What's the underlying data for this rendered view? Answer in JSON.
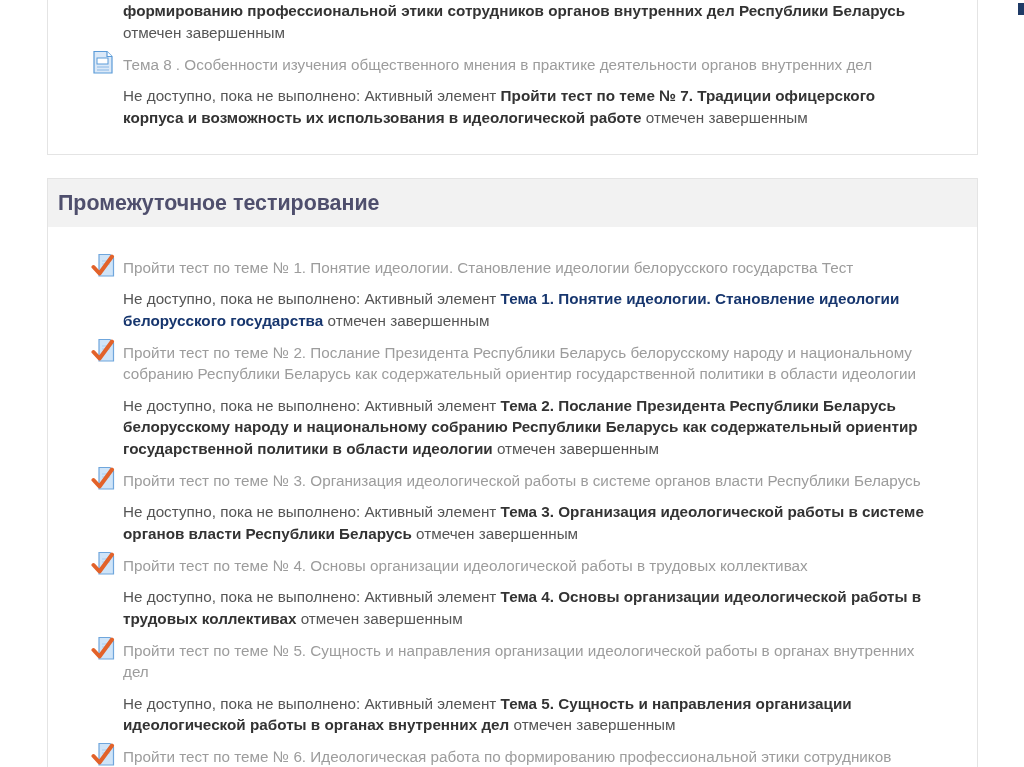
{
  "sections": [
    {
      "cut_top": true,
      "items": [
        {
          "restriction": {
            "target": "формированию профессиональной этики сотрудников органов внутренних дел Республики Беларусь",
            "suffix": "отмечен завершенным",
            "highlighted": false
          }
        },
        {
          "activity": {
            "kind": "page",
            "title": "Тема 8 . Особенности изучения общественного мнения в практике деятельности органов внутренних дел",
            "disabled": true
          },
          "restriction": {
            "prefix": "Не доступно, пока не выполнено: Активный элемент",
            "target": "Пройти тест по теме № 7. Традиции офицерского корпуса и возможность их использования в идеологической работе",
            "suffix": "отмечен завершенным",
            "highlighted": false
          }
        }
      ]
    },
    {
      "cut_top": false,
      "title": "Промежуточное тестирование",
      "items": [
        {
          "activity": {
            "kind": "quiz",
            "title": "Пройти тест по теме № 1. Понятие идеологии. Становление идеологии белорусского государства Тест",
            "disabled": true
          },
          "restriction": {
            "prefix": "Не доступно, пока не выполнено: Активный элемент",
            "target": "Тема 1. Понятие идеологии. Становление идеологии белорусского государства",
            "suffix": "отмечен завершенным",
            "highlighted": true
          }
        },
        {
          "activity": {
            "kind": "quiz",
            "title": "Пройти тест по теме № 2. Послание Президента Республики Беларусь белорусскому народу и национальному собранию Республики Беларусь как содержательный ориентир государственной политики в области идеологии",
            "disabled": true
          },
          "restriction": {
            "prefix": "Не доступно, пока не выполнено: Активный элемент",
            "target": "Тема 2. Послание Президента Республики Беларусь белорусскому народу и национальному собранию Республики Беларусь как содержательный ориентир государственной политики в области идеологии",
            "suffix": "отмечен завершенным",
            "highlighted": false
          }
        },
        {
          "activity": {
            "kind": "quiz",
            "title": "Пройти тест по теме № 3. Организация идеологической работы в системе органов власти Республики Беларусь",
            "disabled": true
          },
          "restriction": {
            "prefix": "Не доступно, пока не выполнено: Активный элемент",
            "target": "Тема 3. Организация идеологической работы в системе органов власти Республики Беларусь",
            "suffix": "отмечен завершенным",
            "highlighted": false
          }
        },
        {
          "activity": {
            "kind": "quiz",
            "title": "Пройти тест по теме № 4. Основы организации идеологической работы в трудовых коллективах",
            "disabled": true
          },
          "restriction": {
            "prefix": "Не доступно, пока не выполнено: Активный элемент",
            "target": "Тема 4. Основы организации идеологической работы в трудовых коллективах",
            "suffix": "отмечен завершенным",
            "highlighted": false
          }
        },
        {
          "activity": {
            "kind": "quiz",
            "title": "Пройти тест по теме № 5. Сущность и направления организации идеологической работы в органах внутренних дел",
            "disabled": true
          },
          "restriction": {
            "prefix": "Не доступно, пока не выполнено: Активный элемент",
            "target": "Тема 5. Сущность и направления организации идеологической работы в органах внутренних дел",
            "suffix": "отмечен завершенным",
            "highlighted": false
          }
        },
        {
          "activity": {
            "kind": "quiz",
            "title": "Пройти тест по теме № 6. Идеологическая работа по формированию профессиональной этики сотрудников",
            "disabled": true
          }
        }
      ]
    }
  ]
}
